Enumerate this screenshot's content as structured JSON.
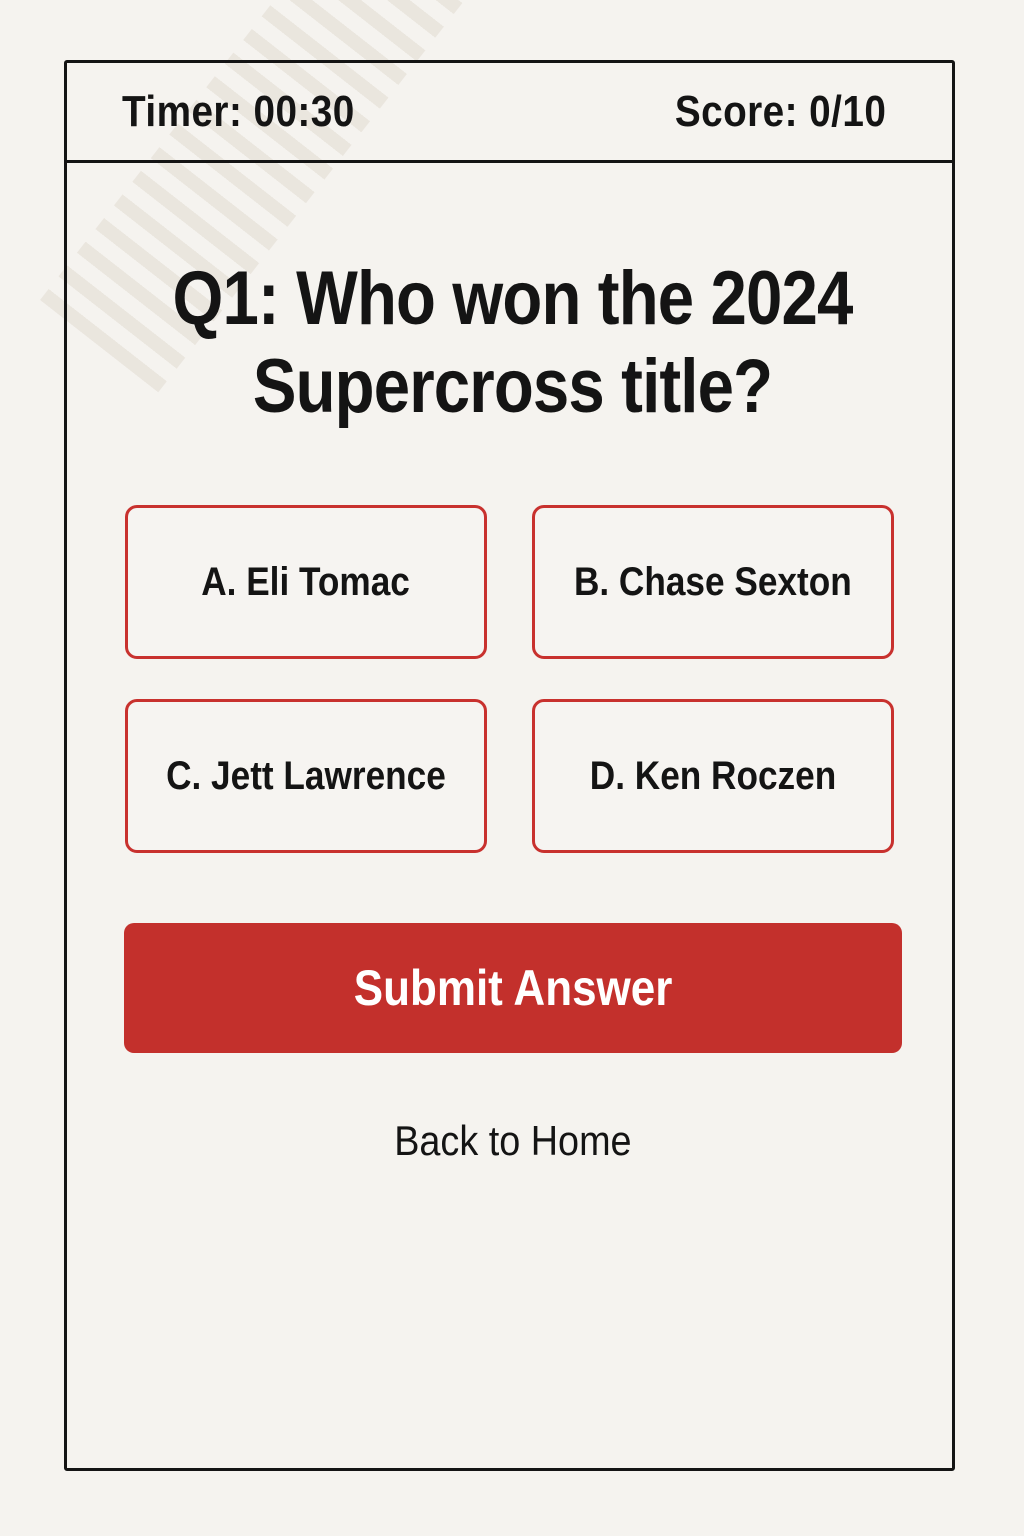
{
  "header": {
    "timer": "Timer: 00:30",
    "score": "Score: 0/10"
  },
  "question": {
    "line1": "Q1: Who won the 2024",
    "line2": "Supercross title?"
  },
  "options": [
    {
      "label": "A. Eli Tomac"
    },
    {
      "label": "B. Chase Sexton"
    },
    {
      "label": "C. Jett Lawrence"
    },
    {
      "label": "D. Ken Roczen"
    }
  ],
  "submit_label": "Submit Answer",
  "back_label": "Back to Home",
  "colors": {
    "accent": "#c3302c",
    "background": "#f5f3ef",
    "text": "#141414"
  }
}
